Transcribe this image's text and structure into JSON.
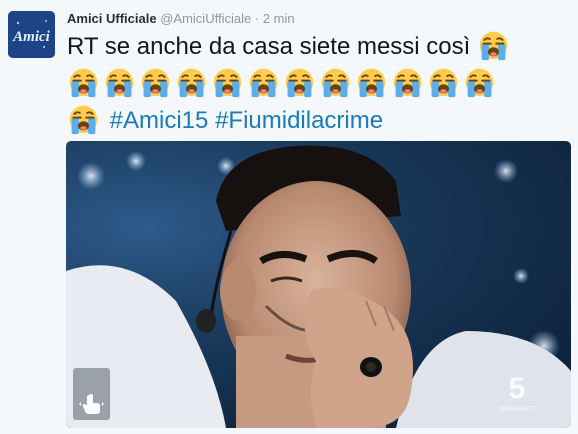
{
  "tweet": {
    "author_name": "Amici Ufficiale",
    "author_handle": "@AmiciUfficiale",
    "separator": "·",
    "timestamp": "2 min",
    "text_line1": "RT se anche da casa siete messi così",
    "hashtags": [
      "#Amici15",
      "#Fiumidilacrime"
    ],
    "emoji_name": "loudly-crying-face",
    "avatar_logo_text": "Amici",
    "media": {
      "kind": "gif",
      "channel_logo_number": "5",
      "channel_logo_text": "MEDIASET"
    }
  },
  "colors": {
    "background": "#f5f8fa",
    "name": "#292f33",
    "meta": "#8899a6",
    "text": "#14171a",
    "hashtag": "#1b7ab8"
  }
}
